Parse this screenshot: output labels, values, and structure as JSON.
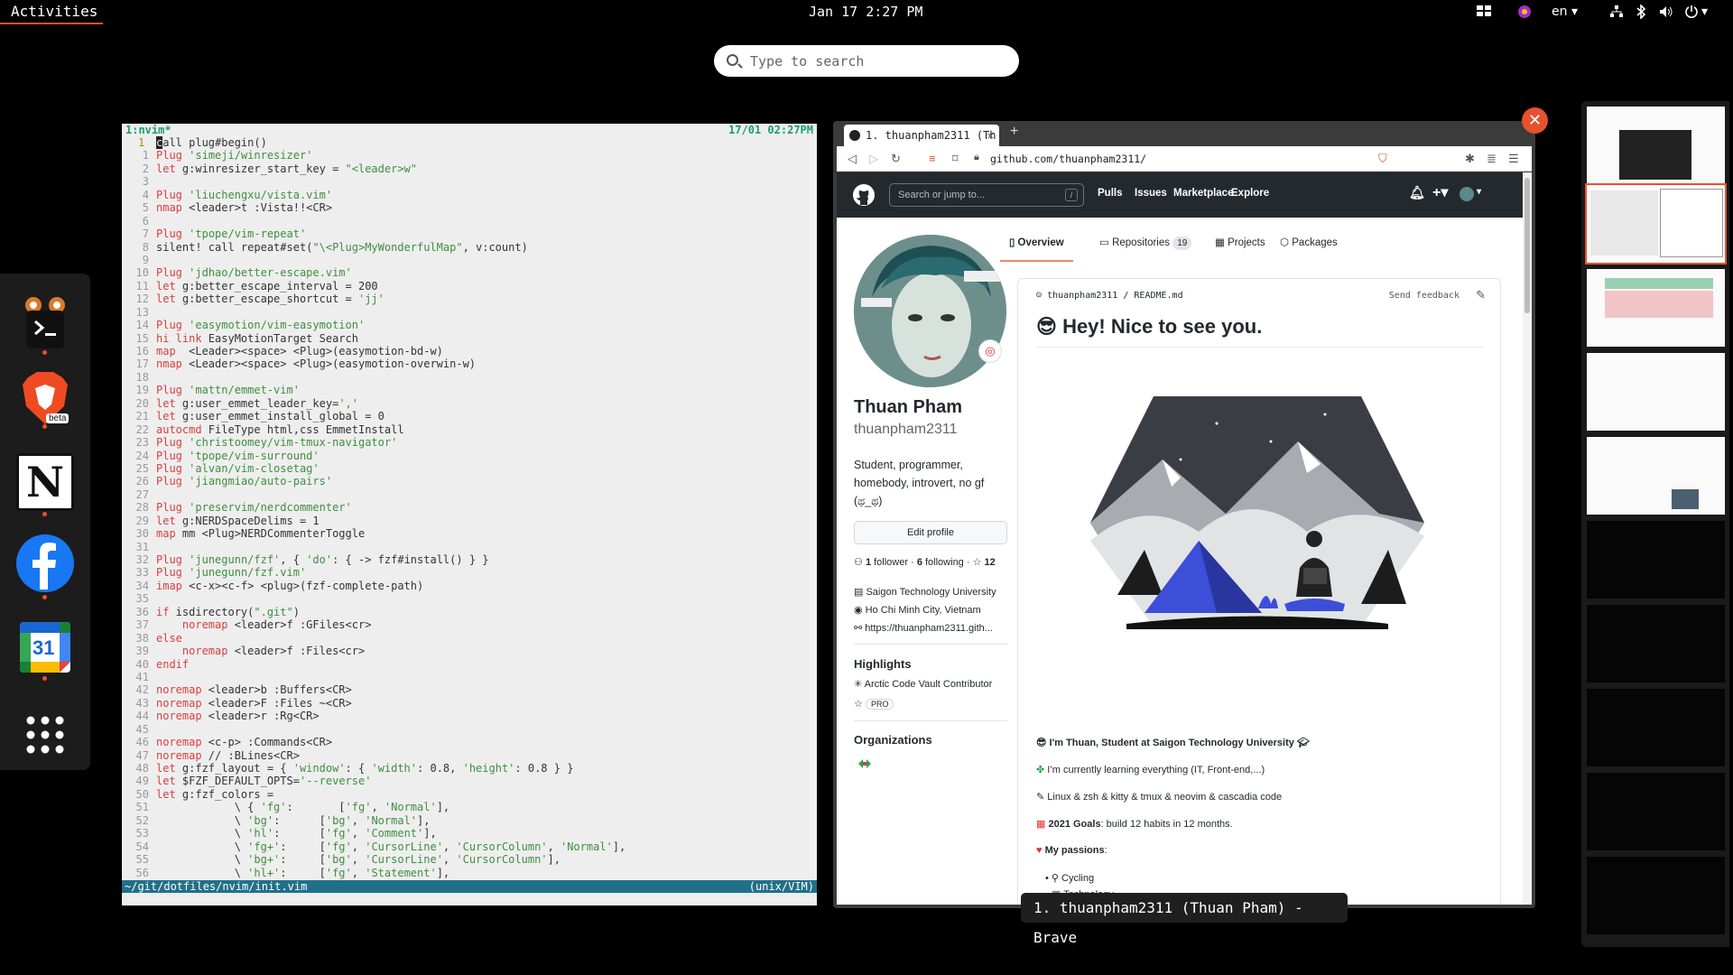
{
  "topbar": {
    "activities": "Activities",
    "clock": "Jan 17  2:27 PM",
    "lang": "en"
  },
  "search": {
    "placeholder": "Type to search"
  },
  "dock": {
    "apps": [
      "Terminal",
      "Brave Beta",
      "Notion",
      "Facebook",
      "Google Calendar",
      "Show Applications"
    ],
    "brave_badge": "beta",
    "calendar_day": "31",
    "notion_letter": "N"
  },
  "vim": {
    "tab_label": "1:nvim*",
    "tab_time": "17/01 02:27PM",
    "status_left": "~/git/dotfiles/nvim/init.vim",
    "status_right": "(unix/VIM)",
    "lines": [
      "call plug#begin()",
      "Plug 'simeji/winresizer'",
      "let g:winresizer_start_key = \"<leader>w\"",
      "",
      "Plug 'liuchengxu/vista.vim'",
      "nmap <leader>t :Vista!!<CR>",
      "",
      "Plug 'tpope/vim-repeat'",
      "silent! call repeat#set(\"\\<Plug>MyWonderfulMap\", v:count)",
      "",
      "Plug 'jdhao/better-escape.vim'",
      "let g:better_escape_interval = 200",
      "let g:better_escape_shortcut = 'jj'",
      "",
      "Plug 'easymotion/vim-easymotion'",
      "hi link EasyMotionTarget Search",
      "map  <Leader><space> <Plug>(easymotion-bd-w)",
      "nmap <Leader><space> <Plug>(easymotion-overwin-w)",
      "",
      "Plug 'mattn/emmet-vim'",
      "let g:user_emmet_leader_key=','",
      "let g:user_emmet_install_global = 0",
      "autocmd FileType html,css EmmetInstall",
      "Plug 'christoomey/vim-tmux-navigator'",
      "Plug 'tpope/vim-surround'",
      "Plug 'alvan/vim-closetag'",
      "Plug 'jiangmiao/auto-pairs'",
      "",
      "Plug 'preservim/nerdcommenter'",
      "let g:NERDSpaceDelims = 1",
      "map mm <Plug>NERDCommenterToggle",
      "",
      "Plug 'junegunn/fzf', { 'do': { -> fzf#install() } }",
      "Plug 'junegunn/fzf.vim'",
      "imap <c-x><c-f> <plug>(fzf-complete-path)",
      "",
      "if isdirectory(\".git\")",
      "    noremap <leader>f :GFiles<cr>",
      "else",
      "    noremap <leader>f :Files<cr>",
      "endif",
      "",
      "noremap <leader>b :Buffers<CR>",
      "noremap <leader>F :Files ~<CR>",
      "noremap <leader>r :Rg<CR>",
      "",
      "noremap <c-p> :Commands<CR>",
      "noremap // :BLines<CR>",
      "let g:fzf_layout = { 'window': { 'width': 0.8, 'height': 0.8 } }",
      "let $FZF_DEFAULT_OPTS='--reverse'",
      "let g:fzf_colors =",
      "            \\ { 'fg':       ['fg', 'Normal'],",
      "            \\ 'bg':      ['bg', 'Normal'],",
      "            \\ 'hl':      ['fg', 'Comment'],",
      "            \\ 'fg+':     ['fg', 'CursorLine', 'CursorColumn', 'Normal'],",
      "            \\ 'bg+':     ['bg', 'CursorLine', 'CursorColumn'],",
      "            \\ 'hl+':     ['fg', 'Statement'],"
    ]
  },
  "browser": {
    "tab_title": "1. thuanpham2311 (Th",
    "url": "github.com/thuanpham2311/",
    "window_label": "1. thuanpham2311 (Thuan Pham) - Brave",
    "github": {
      "search_placeholder": "Search or jump to...",
      "search_key": "/",
      "nav": [
        "Pulls",
        "Issues",
        "Marketplace",
        "Explore"
      ],
      "tabs": {
        "overview": "Overview",
        "repositories": "Repositories",
        "repo_count": "19",
        "projects": "Projects",
        "packages": "Packages"
      },
      "profile": {
        "name": "Thuan Pham",
        "login": "thuanpham2311",
        "bio": "Student, programmer, homebody, introvert, no gf (ಥ_ಥ)",
        "edit": "Edit profile",
        "followers": "1",
        "followers_label": "follower",
        "following": "6",
        "following_label": "following",
        "stars": "12",
        "org": "Saigon Technology University",
        "location": "Ho Chi Minh City, Vietnam",
        "website": "https://thuanpham2311.gith...",
        "highlights_title": "Highlights",
        "highlight_1": "Arctic Code Vault Contributor",
        "highlight_2": "PRO",
        "orgs_title": "Organizations"
      },
      "readme": {
        "path_user": "thuanpham2311",
        "path_file": "README.md",
        "feedback": "Send feedback",
        "heading": "Hey! Nice to see you.",
        "intro": "I'm Thuan, Student at Saigon Technology University",
        "learning": "I’m currently learning everything (IT, Front-end,...)",
        "tools": "Linux & zsh & kitty & tmux & neovim & cascadia code",
        "goals_label": "2021 Goals",
        "goals_text": ": build 12 habits in 12 months.",
        "passions_label": "My passions",
        "passion_1": "Cycling",
        "passion_2": "Technology"
      }
    }
  },
  "colors": {
    "accent": "#e5522f",
    "vim_status": "#21708a",
    "github_header": "#24292e"
  }
}
